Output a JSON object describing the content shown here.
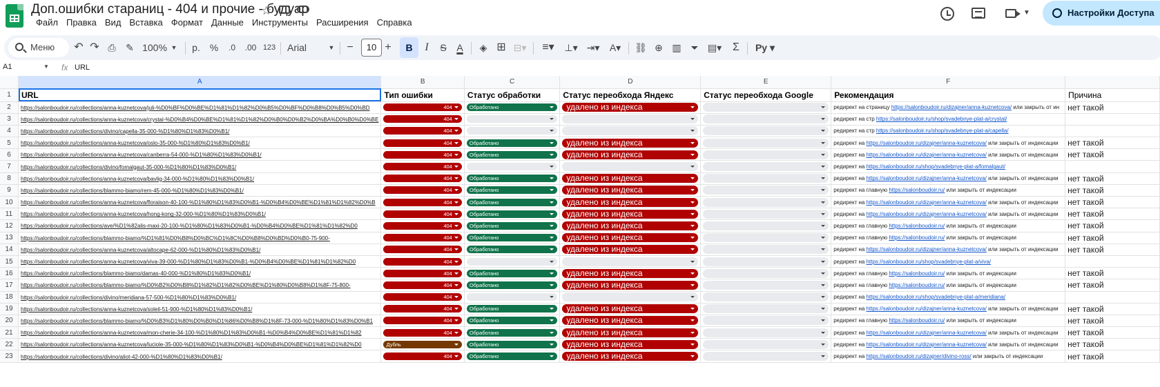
{
  "title": "Доп.ошибки стараниц - 404 и прочие - будуар",
  "menu": [
    "Файл",
    "Правка",
    "Вид",
    "Вставка",
    "Формат",
    "Данные",
    "Инструменты",
    "Расширения",
    "Справка"
  ],
  "share_label": "Настройки Доступа",
  "toolbar": {
    "search": "Меню",
    "zoom": "100%",
    "currency": "р.",
    "percent": "%",
    "dec_less": ".0",
    "dec_more": ".00",
    "format123": "123",
    "font": "Arial",
    "font_size": "10",
    "bold": "B",
    "italic": "I",
    "strike": "S",
    "textcolor": "A"
  },
  "namebox": "A1",
  "formula": "URL",
  "columns": [
    "A",
    "B",
    "C",
    "D",
    "E",
    "F"
  ],
  "headers": {
    "url": "URL",
    "type": "Тип ошибки",
    "status": "Статус обработки",
    "yandex": "Статус переобхода Яндекс",
    "google": "Статус переобхода Google",
    "rec": "Рекомендация",
    "reason": "Причина"
  },
  "labels": {
    "processed": "Обработано",
    "removed": "удалено из индекса",
    "no_such": "нет такой страницы",
    "rec_page": "редирект на страницу",
    "rec_main": "редирект на главную",
    "rec_on": "редирект на",
    "rec_str": "редирект на стр",
    "or_close": "или закрыть от индексации",
    "or_close_short": "или закрыть от ин"
  },
  "colors": {
    "accent": "#1a73e8",
    "red_chip": "#b10202",
    "green_chip": "#11734b",
    "brown_chip": "#753800",
    "sheets_green": "#0f9d58"
  },
  "rows": [
    {
      "n": "2",
      "url": "https://salonboudoir.ru/collections/anna-kuznetcova/juli-%D0%BF%D0%BE%D1%81%D1%82%D0%B5%D0%BF%D0%B8%D0%B5%D0%BD",
      "type": "404",
      "status": "Обработано",
      "yandex": "удалено из индекса",
      "google": "",
      "rec_prefix": "редирект на страницу",
      "rec_link": "https://salonboudoir.ru/dizajner/anna-kuznetcova/",
      "rec_suffix": "или закрыть от ин",
      "reason": "нет такой"
    },
    {
      "n": "3",
      "url": "https://salonboudoir.ru/collections/anna-kuznetcova/crystal-%D0%B4%D0%BE%D1%81%D1%82%D0%B0%D0%B2%D0%BA%D0%B0%D0%BE",
      "type": "404",
      "status": "",
      "yandex": "",
      "google": "",
      "rec_prefix": "редирект на стр",
      "rec_link": "https://salonboudoir.ru/shop/svadebnye-plat-a/crystal/",
      "rec_suffix": "",
      "reason": ""
    },
    {
      "n": "4",
      "url": "https://salonboudoir.ru/collections/divino/capella-35-000-%D1%80%D1%83%D0%B1/",
      "type": "404",
      "status": "",
      "yandex": "",
      "google": "",
      "rec_prefix": "редирект на стр",
      "rec_link": "https://salonboudoir.ru/shop/svadebnye-plat-a/capella/",
      "rec_suffix": "",
      "reason": ""
    },
    {
      "n": "5",
      "url": "https://salonboudoir.ru/collections/anna-kuznetcova/oslo-35-000-%D1%80%D1%83%D0%B1/",
      "type": "404",
      "status": "Обработано",
      "yandex": "удалено из индекса",
      "google": "",
      "rec_prefix": "редирект на",
      "rec_link": "https://salonboudoir.ru/dizajner/anna-kuznetcova/",
      "rec_suffix": "или закрыть от индексации",
      "reason": "нет такой"
    },
    {
      "n": "6",
      "url": "https://salonboudoir.ru/collections/anna-kuznetcova/canberra-54-000-%D1%80%D1%83%D0%B1/",
      "type": "404",
      "status": "Обработано",
      "yandex": "удалено из индекса",
      "google": "",
      "rec_prefix": "редирект на",
      "rec_link": "https://salonboudoir.ru/dizajner/anna-kuznetcova/",
      "rec_suffix": "или закрыть от индексации",
      "reason": "нет такой"
    },
    {
      "n": "7",
      "url": "https://salonboudoir.ru/collections/divino/fomalgaut-35-000-%D1%80%D1%83%D0%B1/",
      "type": "404",
      "status": "",
      "yandex": "",
      "google": "",
      "rec_prefix": "редирект на",
      "rec_link": "https://salonboudoir.ru/shop/svadebnye-plat-a/fomalgaut/",
      "rec_suffix": "",
      "reason": ""
    },
    {
      "n": "8",
      "url": "https://salonboudoir.ru/collections/anna-kuznetcova/bavlig-34-000-%D1%80%D1%83%D0%B1/",
      "type": "404",
      "status": "Обработано",
      "yandex": "удалено из индекса",
      "google": "",
      "rec_prefix": "редирект на",
      "rec_link": "https://salonboudoir.ru/dizajner/anna-kuznetcova/",
      "rec_suffix": "или закрыть от индексации",
      "reason": "нет такой"
    },
    {
      "n": "9",
      "url": "https://salonboudoir.ru/collections/blammo-biamo/rem-45-000-%D1%80%D1%83%D0%B1/",
      "type": "404",
      "status": "Обработано",
      "yandex": "удалено из индекса",
      "google": "",
      "rec_prefix": "редирект на главную",
      "rec_link": "https://salonboudoir.ru/",
      "rec_suffix": "или закрыть от индексации",
      "reason": "нет такой"
    },
    {
      "n": "10",
      "url": "https://salonboudoir.ru/collections/anna-kuznetcova/floraison-40-100-%D1%80%D1%83%D0%B1-%D0%B4%D0%BE%D1%81%D1%82%D0%B",
      "type": "404",
      "status": "Обработано",
      "yandex": "удалено из индекса",
      "google": "",
      "rec_prefix": "редирект на",
      "rec_link": "https://salonboudoir.ru/dizajner/anna-kuznetcova/",
      "rec_suffix": "или закрыть от индексации",
      "reason": "нет такой"
    },
    {
      "n": "11",
      "url": "https://salonboudoir.ru/collections/anna-kuznetcova/hong-kong-32-000-%D1%80%D1%83%D0%B1/",
      "type": "404",
      "status": "Обработано",
      "yandex": "удалено из индекса",
      "google": "",
      "rec_prefix": "редирект на",
      "rec_link": "https://salonboudoir.ru/dizajner/anna-kuznetcova/",
      "rec_suffix": "или закрыть от индексации",
      "reason": "нет такой"
    },
    {
      "n": "12",
      "url": "https://salonboudoir.ru/collections/ave/%D1%82alis-maxi-20-100-%D1%80%D1%83%D0%B1-%D0%B4%D0%BE%D1%81%D1%82%D0",
      "type": "404",
      "status": "Обработано",
      "yandex": "удалено из индекса",
      "google": "",
      "rec_prefix": "редирект на главную",
      "rec_link": "https://salonboudoir.ru/",
      "rec_suffix": "или закрыть от индексации",
      "reason": "нет такой"
    },
    {
      "n": "13",
      "url": "https://salonboudoir.ru/collections/blammo-biamo/%D1%81%D0%B8%D0%BC%D1%8C%D0%B8%D0%BD%D0%B0-75-900-",
      "type": "404",
      "status": "Обработано",
      "yandex": "удалено из индекса",
      "google": "",
      "rec_prefix": "редирект на главную",
      "rec_link": "https://salonboudoir.ru/",
      "rec_suffix": "или закрыть от индексации",
      "reason": "нет такой"
    },
    {
      "n": "14",
      "url": "https://salonboudoir.ru/collections/anna-kuznetcova/altocape-62-000-%D1%80%D1%83%D0%B1/",
      "type": "404",
      "status": "Обработано",
      "yandex": "удалено из индекса",
      "google": "",
      "rec_prefix": "редирект на",
      "rec_link": "https://salonboudoir.ru/dizajner/anna-kuznetcova/",
      "rec_suffix": "или закрыть от индексации",
      "reason": "нет такой"
    },
    {
      "n": "15",
      "url": "https://salonboudoir.ru/collections/anna-kuznetcova/viva-39-000-%D1%80%D1%83%D0%B1-%D0%B4%D0%BE%D1%81%D1%82%D0",
      "type": "404",
      "status": "",
      "yandex": "",
      "google": "",
      "rec_prefix": "редирект на",
      "rec_link": "https://salonboudoir.ru/shop/svadebnye-plat-a/viva/",
      "rec_suffix": "",
      "reason": ""
    },
    {
      "n": "16",
      "url": "https://salonboudoir.ru/collections/blammo-biamo/damas-40-000-%D1%80%D1%83%D0%B1/",
      "type": "404",
      "status": "Обработано",
      "yandex": "удалено из индекса",
      "google": "",
      "rec_prefix": "редирект на главную",
      "rec_link": "https://salonboudoir.ru/",
      "rec_suffix": "или закрыть от индексации",
      "reason": "нет такой"
    },
    {
      "n": "17",
      "url": "https://salonboudoir.ru/collections/blammo-biamo/%D0%B2%D0%B8%D1%82%D1%82%D0%BE%D1%80%D0%B8%D1%8F-75-800-",
      "type": "404",
      "status": "Обработано",
      "yandex": "удалено из индекса",
      "google": "",
      "rec_prefix": "редирект на главную",
      "rec_link": "https://salonboudoir.ru/",
      "rec_suffix": "или закрыть от индексации",
      "reason": "нет такой"
    },
    {
      "n": "18",
      "url": "https://salonboudoir.ru/collections/divino/meridiana-57-500-%D1%80%D1%83%D0%B1/",
      "type": "404",
      "status": "",
      "yandex": "",
      "google": "",
      "rec_prefix": "редирект на",
      "rec_link": "https://salonboudoir.ru/shop/svadebnye-plat-a/meridiana/",
      "rec_suffix": "",
      "reason": ""
    },
    {
      "n": "19",
      "url": "https://salonboudoir.ru/collections/anna-kuznetcova/soleil-51-900-%D1%80%D1%83%D0%B1/",
      "type": "404",
      "status": "Обработано",
      "yandex": "удалено из индекса",
      "google": "",
      "rec_prefix": "редирект на",
      "rec_link": "https://salonboudoir.ru/dizajner/anna-kuznetcova/",
      "rec_suffix": "или закрыть от индексации",
      "reason": "нет такой"
    },
    {
      "n": "20",
      "url": "https://salonboudoir.ru/collections/blammo-biamo/%D0%B3%D1%80%D0%B0%D1%86%D0%B8%D1%8F-73-000-%D1%80%D1%83%D0%B1",
      "type": "404",
      "status": "Обработано",
      "yandex": "удалено из индекса",
      "google": "",
      "rec_prefix": "редирект на главную",
      "rec_link": "https://salonboudoir.ru/",
      "rec_suffix": "или закрыть от индексации",
      "reason": "нет такой"
    },
    {
      "n": "21",
      "url": "https://salonboudoir.ru/collections/anna-kuznetcova/mon-cherie-34-100-%D1%80%D1%83%D0%B1-%D0%B4%D0%BE%D1%81%D1%82",
      "type": "404",
      "status": "Обработано",
      "yandex": "удалено из индекса",
      "google": "",
      "rec_prefix": "редирект на",
      "rec_link": "https://salonboudoir.ru/dizajner/anna-kuznetcova/",
      "rec_suffix": "или закрыть от индексации",
      "reason": "нет такой"
    },
    {
      "n": "22",
      "url": "https://salonboudoir.ru/collections/anna-kuznetcova/luciole-35-000-%D1%80%D1%83%D0%B1-%D0%B4%D0%BE%D1%81%D1%82%D0",
      "type": "Дубль",
      "status": "Обработано",
      "yandex": "удалено из индекса",
      "google": "",
      "rec_prefix": "редирект на",
      "rec_link": "https://salonboudoir.ru/dizajner/anna-kuznetcova/",
      "rec_suffix": "или закрыть от индексации",
      "reason": "нет такой"
    },
    {
      "n": "23",
      "url": "https://salonboudoir.ru/collections/divino/aliot-42-000-%D1%80%D1%83%D0%B1/",
      "type": "404",
      "status": "Обработано",
      "yandex": "удалено из индекса",
      "google": "",
      "rec_prefix": "редирект на",
      "rec_link": "https://salonboudoir.ru/dizajner/divino-ross/",
      "rec_suffix": "или закрыть от индексации",
      "reason": "нет такой"
    }
  ]
}
